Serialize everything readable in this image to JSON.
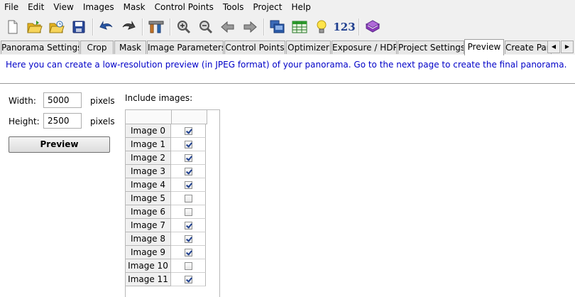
{
  "menu": [
    "File",
    "Edit",
    "View",
    "Images",
    "Mask",
    "Control Points",
    "Tools",
    "Project",
    "Help"
  ],
  "toolbar": {
    "items": [
      "new-icon",
      "open-icon",
      "open-recent-icon",
      "save-icon",
      "undo-icon",
      "redo-icon",
      "assistant-icon",
      "zoom-in-icon",
      "zoom-out-icon",
      "previous-icon",
      "next-icon",
      "fast-preview-icon",
      "table-icon",
      "lightbulb-icon",
      "numbers-icon",
      "book-icon"
    ],
    "numbers_label": "123"
  },
  "tabs": [
    "Panorama Settings",
    "Crop",
    "Mask",
    "Image Parameters",
    "Control Points",
    "Optimizer",
    "Exposure / HDR",
    "Project Settings",
    "Preview",
    "Create Panorama"
  ],
  "active_tab": "Preview",
  "info": "Here you can create a low-resolution preview (in JPEG format) of your panorama. Go to the next page to create the final panorama.",
  "width": {
    "label": "Width:",
    "value": "5000",
    "unit": "pixels"
  },
  "height": {
    "label": "Height:",
    "value": "2500",
    "unit": "pixels"
  },
  "preview_button": "Preview",
  "include_label": "Include images:",
  "images": [
    {
      "name": "Image 0",
      "checked": true
    },
    {
      "name": "Image 1",
      "checked": true
    },
    {
      "name": "Image 2",
      "checked": true
    },
    {
      "name": "Image 3",
      "checked": true
    },
    {
      "name": "Image 4",
      "checked": true
    },
    {
      "name": "Image 5",
      "checked": false
    },
    {
      "name": "Image 6",
      "checked": false
    },
    {
      "name": "Image 7",
      "checked": true
    },
    {
      "name": "Image 8",
      "checked": true
    },
    {
      "name": "Image 9",
      "checked": true
    },
    {
      "name": "Image 10",
      "checked": false
    },
    {
      "name": "Image 11",
      "checked": true
    }
  ]
}
